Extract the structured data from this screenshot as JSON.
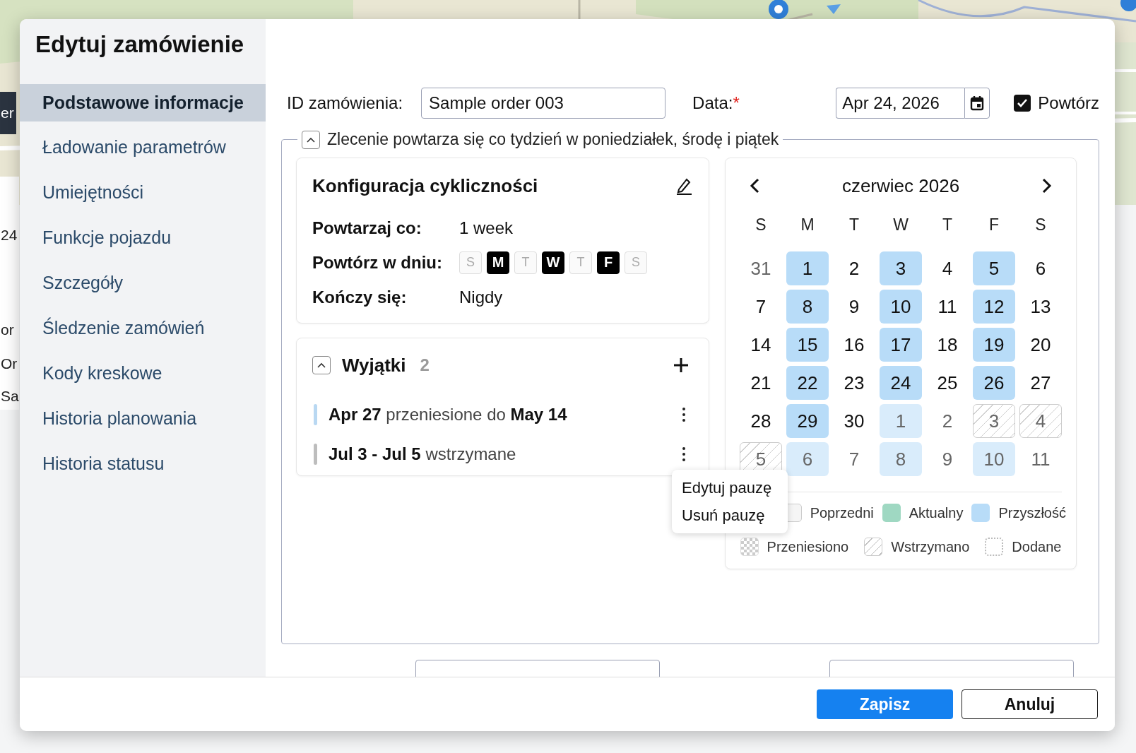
{
  "backdrop": {
    "map": {
      "kind": "picture"
    },
    "fragments": [
      "er",
      "24",
      "or",
      "Or",
      "Sa"
    ]
  },
  "title": "Edytuj zamówienie",
  "nav": [
    {
      "label": "Podstawowe informacje",
      "selected": true
    },
    {
      "label": "Ładowanie parametrów",
      "selected": false
    },
    {
      "label": "Umiejętności",
      "selected": false
    },
    {
      "label": "Funkcje pojazdu",
      "selected": false
    },
    {
      "label": "Szczegóły",
      "selected": false
    },
    {
      "label": "Śledzenie zamówień",
      "selected": false
    },
    {
      "label": "Kody kreskowe",
      "selected": false
    },
    {
      "label": "Historia planowania",
      "selected": false
    },
    {
      "label": "Historia statusu",
      "selected": false
    }
  ],
  "order_id": {
    "label": "ID zamówienia:",
    "value": "Sample order 003"
  },
  "date": {
    "label": "Data:",
    "required_mark": "*",
    "value": "Apr 24, 2026"
  },
  "repeat": {
    "label": "Powtórz",
    "checked": true
  },
  "recurrence": {
    "expanded": true,
    "summary": "Zlecenie powtarza się co tydzień w poniedziałek, środę i piątek",
    "config": {
      "title": "Konfiguracja cykliczności",
      "repeat_every": {
        "label": "Powtarzaj co:",
        "value": "1 week"
      },
      "repeat_on": {
        "label": "Powtórz w dniu:",
        "days": [
          {
            "label": "S",
            "selected": false
          },
          {
            "label": "M",
            "selected": true
          },
          {
            "label": "T",
            "selected": false
          },
          {
            "label": "W",
            "selected": true
          },
          {
            "label": "T",
            "selected": false
          },
          {
            "label": "F",
            "selected": true
          },
          {
            "label": "S",
            "selected": false
          }
        ]
      },
      "ends": {
        "label": "Kończy się:",
        "value": "Nigdy"
      }
    }
  },
  "exceptions": {
    "expanded": true,
    "title": "Wyjątki",
    "count": "2",
    "items": [
      {
        "text": "**Apr 27** przeniesione do **May 14**",
        "color": "#b9d8f2"
      },
      {
        "text": "**Jul 3 - Jul 5** wstrzymane",
        "color": "#bdbdbd"
      }
    ]
  },
  "calendar": {
    "month": "czerwiec 2026",
    "weekdays": [
      "S",
      "M",
      "T",
      "W",
      "T",
      "F",
      "S"
    ],
    "weeks": [
      [
        {
          "day": "31",
          "kind": "plain",
          "outside": true
        },
        {
          "day": "1",
          "kind": "future",
          "outside": false
        },
        {
          "day": "2",
          "kind": "plain",
          "outside": false
        },
        {
          "day": "3",
          "kind": "future",
          "outside": false
        },
        {
          "day": "4",
          "kind": "plain",
          "outside": false
        },
        {
          "day": "5",
          "kind": "future",
          "outside": false
        },
        {
          "day": "6",
          "kind": "plain",
          "outside": false
        }
      ],
      [
        {
          "day": "7",
          "kind": "plain",
          "outside": false
        },
        {
          "day": "8",
          "kind": "future",
          "outside": false
        },
        {
          "day": "9",
          "kind": "plain",
          "outside": false
        },
        {
          "day": "10",
          "kind": "future",
          "outside": false
        },
        {
          "day": "11",
          "kind": "plain",
          "outside": false
        },
        {
          "day": "12",
          "kind": "future",
          "outside": false
        },
        {
          "day": "13",
          "kind": "plain",
          "outside": false
        }
      ],
      [
        {
          "day": "14",
          "kind": "plain",
          "outside": false
        },
        {
          "day": "15",
          "kind": "future",
          "outside": false
        },
        {
          "day": "16",
          "kind": "plain",
          "outside": false
        },
        {
          "day": "17",
          "kind": "future",
          "outside": false
        },
        {
          "day": "18",
          "kind": "plain",
          "outside": false
        },
        {
          "day": "19",
          "kind": "future",
          "outside": false
        },
        {
          "day": "20",
          "kind": "plain",
          "outside": false
        }
      ],
      [
        {
          "day": "21",
          "kind": "plain",
          "outside": false
        },
        {
          "day": "22",
          "kind": "future",
          "outside": false
        },
        {
          "day": "23",
          "kind": "plain",
          "outside": false
        },
        {
          "day": "24",
          "kind": "future",
          "outside": false
        },
        {
          "day": "25",
          "kind": "plain",
          "outside": false
        },
        {
          "day": "26",
          "kind": "future",
          "outside": false
        },
        {
          "day": "27",
          "kind": "plain",
          "outside": false
        }
      ],
      [
        {
          "day": "28",
          "kind": "plain",
          "outside": false
        },
        {
          "day": "29",
          "kind": "future",
          "outside": false
        },
        {
          "day": "30",
          "kind": "plain",
          "outside": false
        },
        {
          "day": "1",
          "kind": "future",
          "outside": true
        },
        {
          "day": "2",
          "kind": "plain",
          "outside": true
        },
        {
          "day": "3",
          "kind": "paused",
          "outside": true
        },
        {
          "day": "4",
          "kind": "paused",
          "outside": true
        }
      ],
      [
        {
          "day": "5",
          "kind": "paused",
          "outside": true
        },
        {
          "day": "6",
          "kind": "future",
          "outside": true
        },
        {
          "day": "7",
          "kind": "plain",
          "outside": true
        },
        {
          "day": "8",
          "kind": "future",
          "outside": true
        },
        {
          "day": "9",
          "kind": "plain",
          "outside": true
        },
        {
          "day": "10",
          "kind": "future",
          "outside": true
        },
        {
          "day": "11",
          "kind": "plain",
          "outside": true
        }
      ]
    ],
    "legend": [
      {
        "kind": "previous",
        "label": "Poprzedni"
      },
      {
        "kind": "current",
        "label": "Aktualny"
      },
      {
        "kind": "future",
        "label": "Przyszłość"
      },
      {
        "kind": "moved",
        "label": "Przeniesiono"
      },
      {
        "kind": "paused",
        "label": "Wstrzymano"
      },
      {
        "kind": "added",
        "label": "Dodane"
      }
    ]
  },
  "menu": {
    "items": [
      "Edytuj pauzę",
      "Usuń pauzę"
    ]
  },
  "buttons": [
    {
      "label": "Zapisz",
      "kind": "primary"
    },
    {
      "label": "Anuluj",
      "kind": "secondary"
    }
  ]
}
